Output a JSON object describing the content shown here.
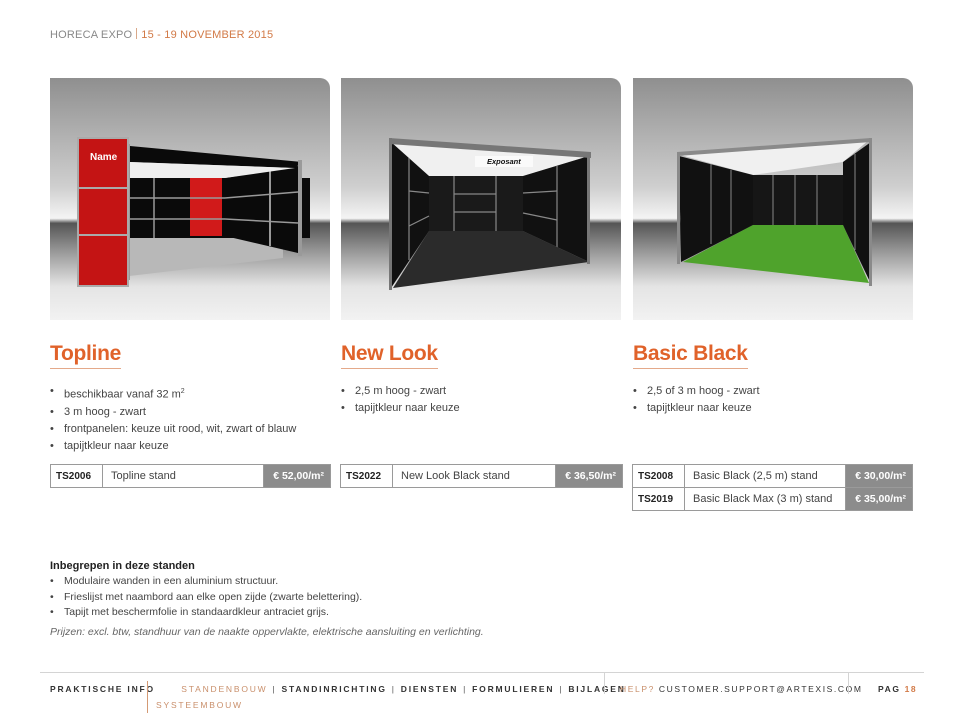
{
  "header": {
    "event": "HORECA EXPO",
    "dates": "15 - 19 NOVEMBER 2015"
  },
  "colors": {
    "accent": "#e0622a",
    "price_bg": "#8c8c8c",
    "footer_accent": "#c98f6b"
  },
  "stands": [
    {
      "title": "Topline",
      "photo": {
        "sign_label": "Name",
        "floor_color": "#b8b8b8"
      },
      "bullets": [
        {
          "text": "beschikbaar vanaf 32 m",
          "sup": "2"
        },
        {
          "text": "3 m hoog - zwart",
          "sup": ""
        },
        {
          "text": "frontpanelen: keuze uit rood, wit, zwart of blauw",
          "sup": ""
        },
        {
          "text": "tapijtkleur naar keuze",
          "sup": ""
        }
      ],
      "prices": [
        {
          "code": "TS2006",
          "description": "Topline stand",
          "price": "€ 52,00/m²"
        }
      ]
    },
    {
      "title": "New Look",
      "photo": {
        "sign_label": "Exposant",
        "floor_color": "#2b2b2b"
      },
      "bullets": [
        {
          "text": "2,5 m hoog - zwart",
          "sup": ""
        },
        {
          "text": "tapijtkleur naar keuze",
          "sup": ""
        }
      ],
      "prices": [
        {
          "code": "TS2022",
          "description": "New Look Black stand",
          "price": "€ 36,50/m²"
        }
      ]
    },
    {
      "title": "Basic Black",
      "photo": {
        "sign_label": "",
        "floor_color": "#4fa32c"
      },
      "bullets": [
        {
          "text": "2,5 of 3 m hoog - zwart",
          "sup": ""
        },
        {
          "text": "tapijtkleur naar keuze",
          "sup": ""
        }
      ],
      "prices": [
        {
          "code": "TS2008",
          "description": "Basic Black (2,5 m) stand",
          "price": "€ 30,00/m²"
        },
        {
          "code": "TS2019",
          "description": "Basic Black Max (3 m) stand",
          "price": "€ 35,00/m²"
        }
      ]
    }
  ],
  "included": {
    "heading": "Inbegrepen in deze standen",
    "items": [
      "Modulaire wanden in een aluminium structuur.",
      "Frieslijst met naambord aan elke open zijde (zwarte belettering).",
      "Tapijt met beschermfolie in standaardkleur antraciet grijs."
    ],
    "note": "Prijzen: excl. btw, standhuur van de naakte oppervlakte, elektrische aansluiting en verlichting."
  },
  "footer": {
    "nav": [
      {
        "label": "PRAKTISCHE INFO",
        "active": false
      },
      {
        "label": "STANDENBOUW",
        "active": true
      },
      {
        "label": "STANDINRICHTING",
        "active": false
      },
      {
        "label": "DIENSTEN",
        "active": false
      },
      {
        "label": "FORMULIEREN",
        "active": false
      },
      {
        "label": "BIJLAGEN",
        "active": false
      }
    ],
    "sub_nav": "SYSTEEMBOUW",
    "help_label": "HELP?",
    "help_email": "CUSTOMER.SUPPORT@ARTEXIS.COM",
    "page_label": "PAG",
    "page_number": "18"
  }
}
